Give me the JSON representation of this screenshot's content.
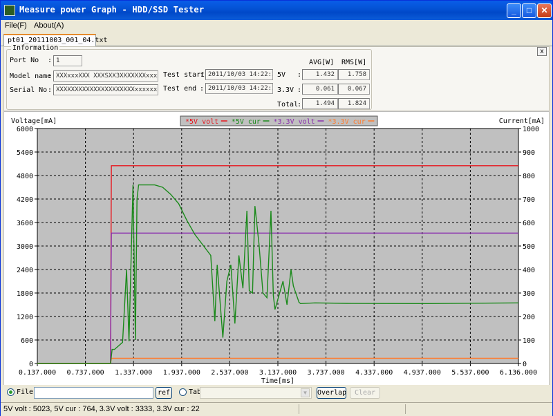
{
  "window": {
    "title": "Measure power Graph - HDD/SSD Tester"
  },
  "menu": {
    "file": "File(F)",
    "about": "About(A)"
  },
  "tab": {
    "label": "pt01_20111003_001_04.txt"
  },
  "close_panel": "x",
  "info": {
    "group_label": "Information",
    "port_label": "Port No",
    "port_value": "1",
    "model_label": "Model name",
    "model_value": "XXXxxxXXX XXXSXX3XXXXXXXxxxxxxx",
    "serial_label": "Serial No",
    "serial_value": "XXXXXXXXXXXXXXXXXXXXXxxxxxx",
    "start_label": "Test start",
    "start_value": "2011/10/03 14:22:20",
    "end_label": "Test end",
    "end_value": "2011/10/03 14:22:26",
    "avg_header": "AVG[W]",
    "rms_header": "RMS[W]",
    "rows": [
      {
        "label": "5V",
        "avg": "1.432",
        "rms": "1.758"
      },
      {
        "label": "3.3V",
        "avg": "0.061",
        "rms": "0.067"
      },
      {
        "label": "Total",
        "avg": "1.494",
        "rms": "1.824"
      }
    ]
  },
  "chart_data": {
    "type": "line",
    "ylabel_left": "Voltage[mA]",
    "ylabel_right": "Current[mA]",
    "xlabel": "Time[ms]",
    "legend": [
      {
        "name": "*5V volt",
        "color": "#e8141c"
      },
      {
        "name": "*5V cur",
        "color": "#1a8a1a"
      },
      {
        "name": "*3.3V volt",
        "color": "#8a2fae"
      },
      {
        "name": "*3.3V cur",
        "color": "#ff7b2c"
      }
    ],
    "x_ticks": [
      "0.137.000",
      "0.737.000",
      "1.337.000",
      "1.937.000",
      "2.537.000",
      "3.137.000",
      "3.737.000",
      "4.337.000",
      "4.937.000",
      "5.537.000",
      "6.136.000"
    ],
    "y_left_ticks": [
      "6000",
      "5400",
      "4800",
      "4200",
      "3600",
      "3000",
      "2400",
      "1800",
      "1200",
      "600",
      "0"
    ],
    "y_right_ticks": [
      "1000",
      "900",
      "800",
      "700",
      "600",
      "500",
      "400",
      "300",
      "200",
      "100",
      "0"
    ],
    "xlim": [
      0.137,
      6.136
    ],
    "ylim_left": [
      0,
      6000
    ],
    "ylim_right": [
      0,
      1000
    ],
    "grid": true,
    "series": [
      {
        "name": "*5V volt",
        "axis": "left",
        "x": [
          0.137,
          1.05,
          1.06,
          6.136
        ],
        "y": [
          0,
          0,
          5050,
          5050
        ]
      },
      {
        "name": "*3.3V volt",
        "axis": "left",
        "x": [
          0.137,
          1.05,
          1.06,
          6.136
        ],
        "y": [
          0,
          0,
          3330,
          3330
        ]
      },
      {
        "name": "*3.3V cur",
        "axis": "right",
        "x": [
          0.137,
          1.05,
          1.06,
          6.136
        ],
        "y": [
          0,
          0,
          22,
          22
        ]
      },
      {
        "name": "*5V cur",
        "axis": "right",
        "x": [
          0.137,
          1.05,
          1.07,
          1.1,
          1.2,
          1.25,
          1.28,
          1.33,
          1.36,
          1.38,
          1.4,
          1.6,
          1.7,
          1.8,
          1.9,
          2.0,
          2.1,
          2.3,
          2.35,
          2.38,
          2.45,
          2.5,
          2.55,
          2.6,
          2.65,
          2.7,
          2.75,
          2.78,
          2.82,
          2.85,
          2.9,
          2.95,
          3.0,
          3.05,
          3.08,
          3.1,
          3.2,
          3.25,
          3.3,
          3.33,
          3.4,
          3.42,
          3.6,
          4.0,
          5.0,
          6.136
        ],
        "y": [
          0,
          0,
          60,
          60,
          90,
          400,
          95,
          760,
          100,
          700,
          760,
          760,
          750,
          720,
          680,
          610,
          550,
          460,
          180,
          420,
          110,
          350,
          420,
          170,
          460,
          320,
          650,
          310,
          300,
          670,
          510,
          300,
          280,
          650,
          290,
          230,
          350,
          250,
          400,
          330,
          260,
          255,
          258,
          256,
          255,
          258
        ]
      }
    ]
  },
  "bottom": {
    "file_label": "File",
    "ref_label": "ref",
    "tab_label": "Tab",
    "overlap_label": "Overlap",
    "clear_label": "Clear"
  },
  "status": {
    "text": "5V volt : 5023, 5V cur : 764, 3.3V volt : 3333, 3.3V cur : 22"
  }
}
